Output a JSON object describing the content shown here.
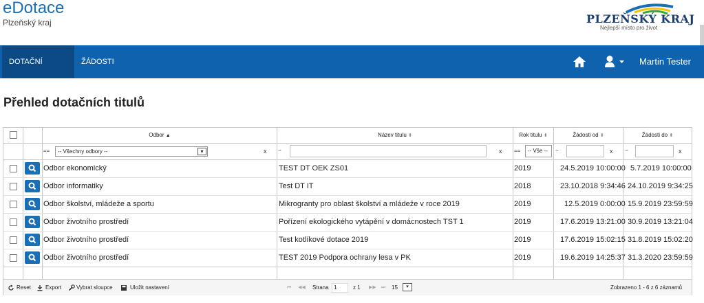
{
  "header": {
    "app_title": "eDotace",
    "app_subtitle": "Plzeňský kraj",
    "logo_name": "PLZEŇSKÝ KRAJ",
    "logo_tagline": "Nejlepší místo pro život"
  },
  "nav": {
    "items": [
      {
        "label": "DOTAČNÍ TITULY",
        "active": true
      },
      {
        "label": "ŽÁDOSTI",
        "active": false
      }
    ],
    "home_icon": "home-icon",
    "user_icon": "user-icon",
    "username": "Martin Tester"
  },
  "page": {
    "title": "Přehled dotačních titulů"
  },
  "grid": {
    "columns": [
      {
        "label": "Odbor",
        "sort": "asc"
      },
      {
        "label": "Název titulu",
        "sort": "none"
      },
      {
        "label": "Rok titulu",
        "sort": "none"
      },
      {
        "label": "Žádosti od",
        "sort": "none"
      },
      {
        "label": "Žádosti do",
        "sort": "none"
      }
    ],
    "filters": {
      "odbor_op": "==",
      "odbor_value": "-- Všechny odbory --",
      "nazev_op": "~",
      "rok_op": "==",
      "rok_value": "-- Vše --",
      "od_op": "~",
      "do_op": "~",
      "clear": "x"
    },
    "rows": [
      {
        "odbor": "Odbor ekonomický",
        "nazev": "TEST DT OEK ZS01",
        "rok": "2019",
        "od": "24.5.2019 10:00:00",
        "do": "5.7.2019 10:00:00"
      },
      {
        "odbor": "Odbor informatiky",
        "nazev": "Test DT IT",
        "rok": "2018",
        "od": "23.10.2018 9:34:46",
        "do": "24.10.2019 9:34:25"
      },
      {
        "odbor": "Odbor školství, mládeže a sportu",
        "nazev": "Mikrogranty pro oblast školství a mládeže v roce 2019",
        "rok": "2019",
        "od": "12.5.2019 0:00:00",
        "do": "15.9.2019 23:59:59"
      },
      {
        "odbor": "Odbor životního prostředí",
        "nazev": "Pořízení ekologického vytápění v domácnostech TST 1",
        "rok": "2019",
        "od": "17.6.2019 13:21:00",
        "do": "30.9.2019 13:21:04"
      },
      {
        "odbor": "Odbor životního prostředí",
        "nazev": "Test kotlíkové dotace 2019",
        "rok": "2019",
        "od": "17.6.2019 15:02:15",
        "do": "31.8.2019 15:02:20"
      },
      {
        "odbor": "Odbor životního prostředí",
        "nazev": "TEST 2019 Podpora ochrany lesa v PK",
        "rok": "2019",
        "od": "19.6.2019 14:25:37",
        "do": "31.3.2020 23:59:59"
      }
    ],
    "footer": {
      "reset": "Reset",
      "export": "Export",
      "columns": "Vybrat sloupce",
      "save": "Uložit nastavení",
      "page_label": "Strana",
      "page_value": "1",
      "page_total": "z 1",
      "page_size": "15",
      "summary": "Zobrazeno 1 - 6 z 6 záznamů"
    }
  },
  "colors": {
    "nav": "#0f62ad",
    "nav_active": "#0b4a85",
    "brand": "#1a6fb5"
  }
}
